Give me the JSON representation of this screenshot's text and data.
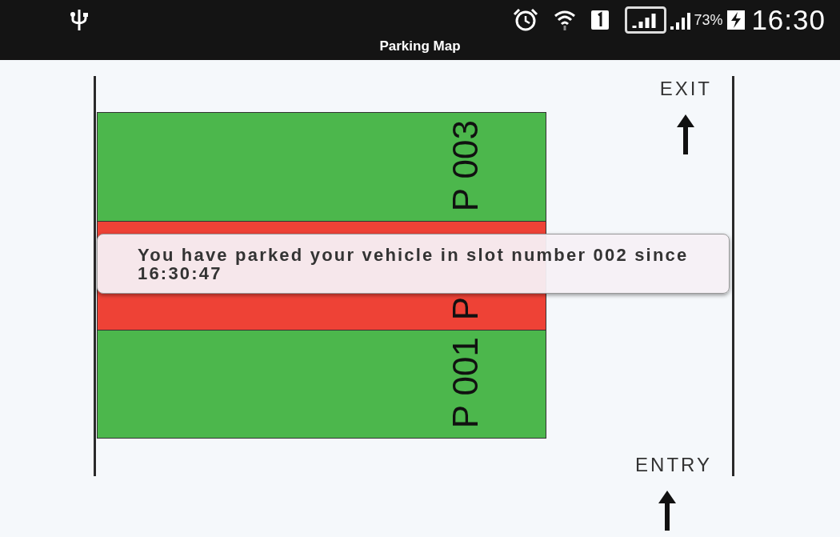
{
  "status_bar": {
    "battery": "73%",
    "time": "16:30"
  },
  "title": "Parking Map",
  "map": {
    "exit_label": "EXIT",
    "entry_label": "ENTRY",
    "slots": [
      {
        "label": "P 003",
        "occupied": false
      },
      {
        "label": "P",
        "occupied": true
      },
      {
        "label": "P 001",
        "occupied": false
      }
    ]
  },
  "toast": {
    "message": "You have parked your vehicle in slot number 002 since 16:30:47"
  }
}
